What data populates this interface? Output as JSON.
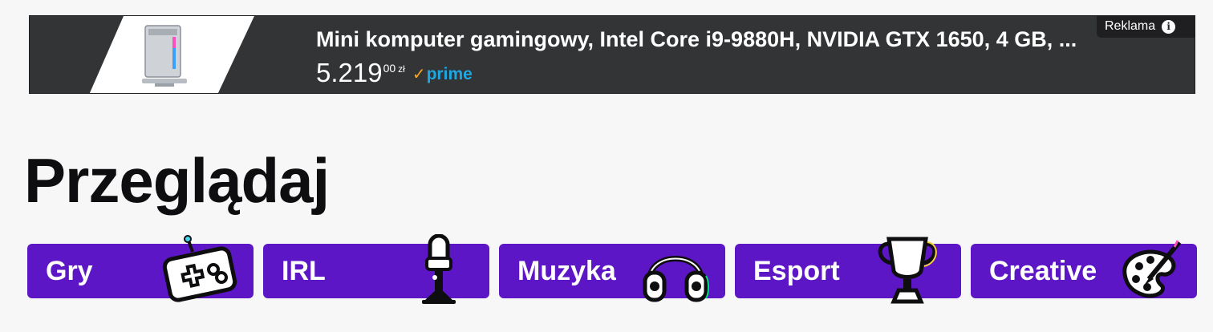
{
  "ad": {
    "title": "Mini komputer gamingowy, Intel Core i9-9880H, NVIDIA GTX 1650, 4 GB, ...",
    "price_whole": "5.219",
    "price_fraction": "00",
    "price_currency": "zł",
    "prime_label": "prime",
    "sponsored_label": "Reklama",
    "info_glyph": "i"
  },
  "page": {
    "heading": "Przeglądaj"
  },
  "categories": [
    {
      "label": "Gry",
      "icon": "gamepad-icon"
    },
    {
      "label": "IRL",
      "icon": "microphone-icon"
    },
    {
      "label": "Muzyka",
      "icon": "headphones-icon"
    },
    {
      "label": "Esport",
      "icon": "trophy-icon"
    },
    {
      "label": "Creative",
      "icon": "paint-palette-icon"
    }
  ],
  "colors": {
    "category_bg": "#5c16c5",
    "ad_bg": "#323436",
    "prime_blue": "#1ea7e1",
    "prime_check": "#f5a623"
  }
}
